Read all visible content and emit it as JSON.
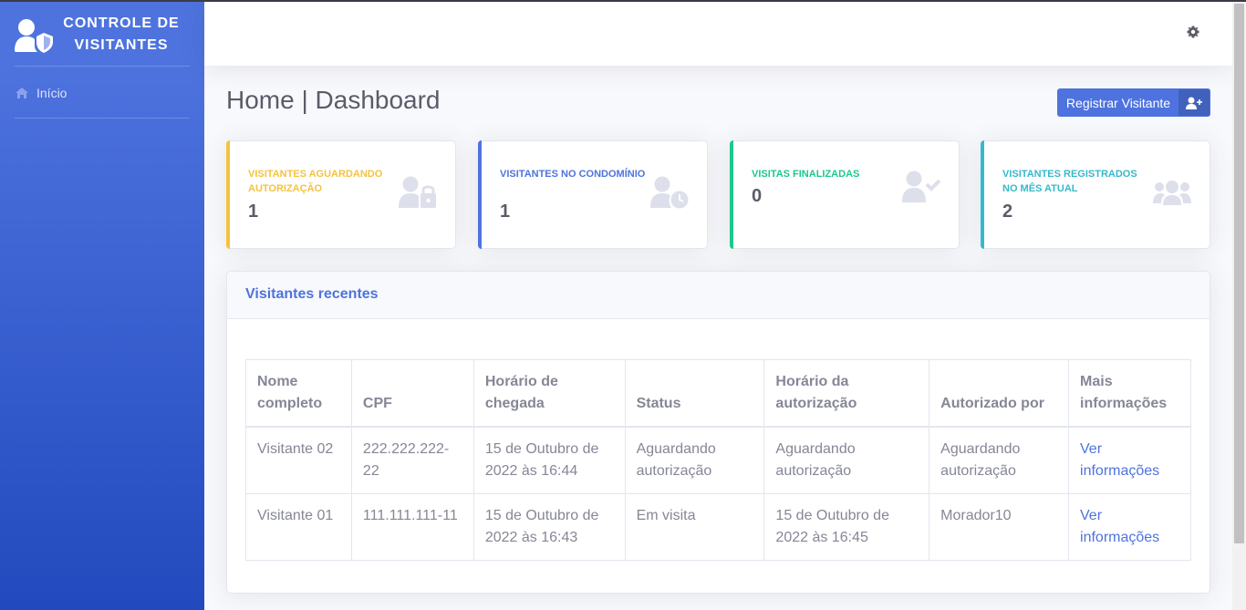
{
  "app": {
    "brand": "CONTROLE DE VISITANTES"
  },
  "sidebar": {
    "items": [
      {
        "label": "Início",
        "icon": "home-icon"
      }
    ]
  },
  "main": {
    "title": "Home | Dashboard",
    "register_button": "Registrar Visitante"
  },
  "cards": [
    {
      "title": "VISITANTES AGUARDANDO AUTORIZAÇÃO",
      "value": "1",
      "color": "#f6c23e",
      "icon": "user-lock-icon"
    },
    {
      "title": "VISITANTES NO CONDOMÍNIO",
      "value": "1",
      "color": "#4e73df",
      "icon": "user-clock-icon"
    },
    {
      "title": "VISITAS FINALIZADAS",
      "value": "0",
      "color": "#1cc88a",
      "icon": "user-check-icon"
    },
    {
      "title": "VISITANTES REGISTRADOS NO MÊS ATUAL",
      "value": "2",
      "color": "#36b9cc",
      "icon": "users-icon"
    }
  ],
  "recent": {
    "title": "Visitantes recentes",
    "columns": [
      "Nome completo",
      "CPF",
      "Horário de chegada",
      "Status",
      "Horário da autorização",
      "Autorizado por",
      "Mais informações"
    ],
    "rows": [
      [
        "Visitante 02",
        "222.222.222-22",
        "15 de Outubro de 2022 às 16:44",
        "Aguardando autorização",
        "Aguardando autorização",
        "Aguardando autorização",
        "Ver informações"
      ],
      [
        "Visitante 01",
        "111.111.111-11",
        "15 de Outubro de 2022 às 16:43",
        "Em visita",
        "15 de Outubro de 2022 às 16:45",
        "Morador10",
        "Ver informações"
      ]
    ]
  },
  "colors": {
    "primary": "#4e73df",
    "warning": "#f6c23e",
    "success": "#1cc88a",
    "info": "#36b9cc"
  }
}
